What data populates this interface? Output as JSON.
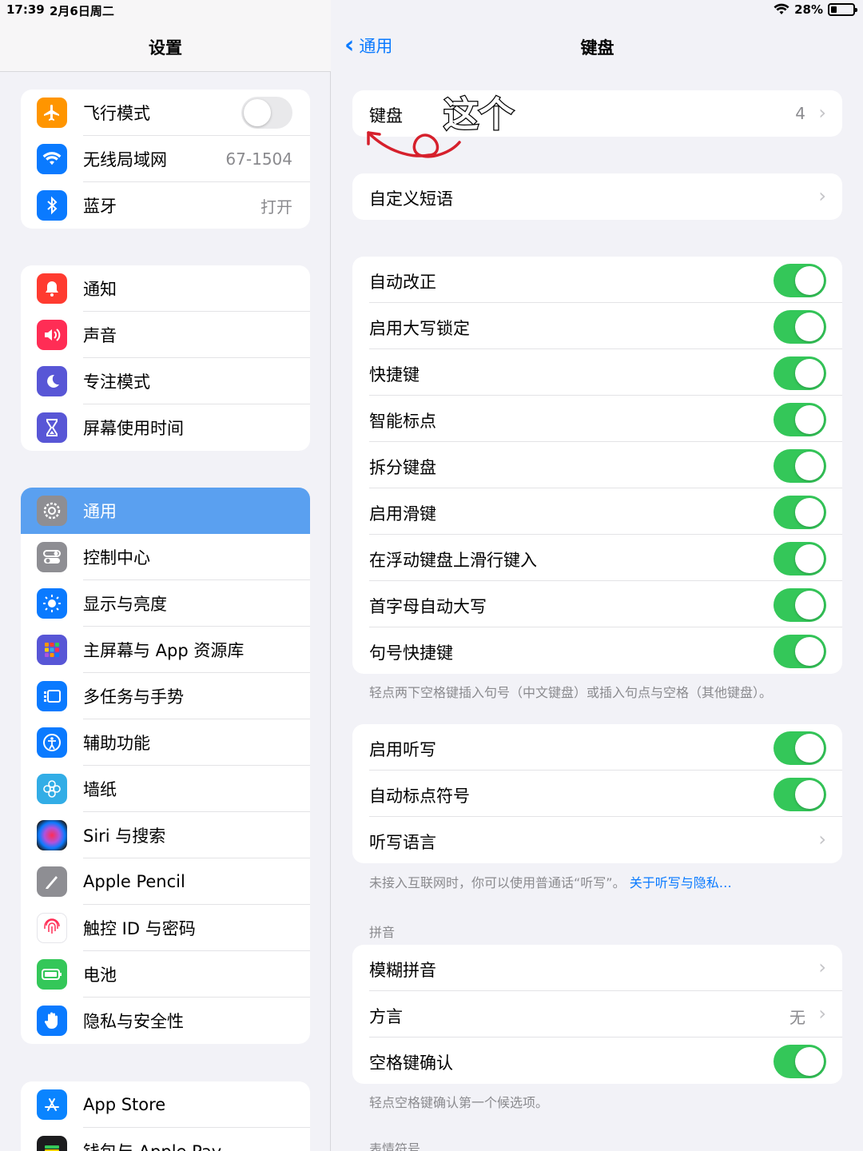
{
  "status": {
    "time": "17:39",
    "date": "2月6日周二",
    "battery": "28%",
    "battery_level": 0.28
  },
  "sidebar": {
    "title": "设置",
    "groups": [
      [
        {
          "label": "飞行模式",
          "icon": "airplane-icon",
          "color": "#ff9500",
          "toggle": false
        },
        {
          "label": "无线局域网",
          "icon": "wifi-icon",
          "color": "#0a7aff",
          "value": "67-1504"
        },
        {
          "label": "蓝牙",
          "icon": "bluetooth-icon",
          "color": "#0a7aff",
          "value": "打开"
        }
      ],
      [
        {
          "label": "通知",
          "icon": "bell-icon",
          "color": "#ff3b30"
        },
        {
          "label": "声音",
          "icon": "speaker-icon",
          "color": "#ff2d55"
        },
        {
          "label": "专注模式",
          "icon": "moon-icon",
          "color": "#5856d6"
        },
        {
          "label": "屏幕使用时间",
          "icon": "hourglass-icon",
          "color": "#5856d6"
        }
      ],
      [
        {
          "label": "通用",
          "icon": "gear-icon",
          "color": "#8e8e93",
          "selected": true
        },
        {
          "label": "控制中心",
          "icon": "switches-icon",
          "color": "#8e8e93"
        },
        {
          "label": "显示与亮度",
          "icon": "sun-icon",
          "color": "#0a7aff"
        },
        {
          "label": "主屏幕与 App 资源库",
          "icon": "grid-icon",
          "color": "#5856d6"
        },
        {
          "label": "多任务与手势",
          "icon": "multitask-icon",
          "color": "#0a7aff"
        },
        {
          "label": "辅助功能",
          "icon": "accessibility-icon",
          "color": "#0a7aff"
        },
        {
          "label": "墙纸",
          "icon": "flower-icon",
          "color": "#32ade6"
        },
        {
          "label": "Siri 与搜索",
          "icon": "siri-icon",
          "color": "#1c1c1e"
        },
        {
          "label": "Apple Pencil",
          "icon": "pencil-icon",
          "color": "#8e8e93"
        },
        {
          "label": "触控 ID 与密码",
          "icon": "fingerprint-icon",
          "color": "#ffffff"
        },
        {
          "label": "电池",
          "icon": "battery-icon",
          "color": "#34c759"
        },
        {
          "label": "隐私与安全性",
          "icon": "hand-icon",
          "color": "#0a7aff"
        }
      ],
      [
        {
          "label": "App Store",
          "icon": "appstore-icon",
          "color": "#0a84ff"
        },
        {
          "label": "钱包与 Apple Pay",
          "icon": "wallet-icon",
          "color": "#1c1c1e"
        }
      ]
    ]
  },
  "detail": {
    "back_label": "通用",
    "title": "键盘",
    "annotation_text": "这个",
    "keyboards": {
      "label": "键盘",
      "value": "4"
    },
    "text_replacement": {
      "label": "自定义短语"
    },
    "toggles": [
      {
        "label": "自动改正",
        "on": true
      },
      {
        "label": "启用大写锁定",
        "on": true
      },
      {
        "label": "快捷键",
        "on": true
      },
      {
        "label": "智能标点",
        "on": true
      },
      {
        "label": "拆分键盘",
        "on": true
      },
      {
        "label": "启用滑键",
        "on": true
      },
      {
        "label": "在浮动键盘上滑行键入",
        "on": true
      },
      {
        "label": "首字母自动大写",
        "on": true
      },
      {
        "label": "句号快捷键",
        "on": true
      }
    ],
    "period_footnote": "轻点两下空格键插入句号（中文键盘）或插入句点与空格（其他键盘）。",
    "dictation": {
      "enable": {
        "label": "启用听写",
        "on": true
      },
      "auto_punct": {
        "label": "自动标点符号",
        "on": true
      },
      "language": {
        "label": "听写语言"
      }
    },
    "dictation_footnote": "未接入互联网时，你可以使用普通话“听写”。",
    "dictation_link": "关于听写与隐私…",
    "pinyin_header": "拼音",
    "pinyin": {
      "fuzzy": {
        "label": "模糊拼音"
      },
      "dialect": {
        "label": "方言",
        "value": "无"
      },
      "space_confirm": {
        "label": "空格键确认",
        "on": true
      }
    },
    "space_footnote": "轻点空格键确认第一个候选项。",
    "emoji_header": "表情符号"
  },
  "colors": {
    "accent": "#0a7aff",
    "toggle_on": "#34c759",
    "selected_row": "#5aa0f0",
    "annotation_red": "#d6202c"
  }
}
